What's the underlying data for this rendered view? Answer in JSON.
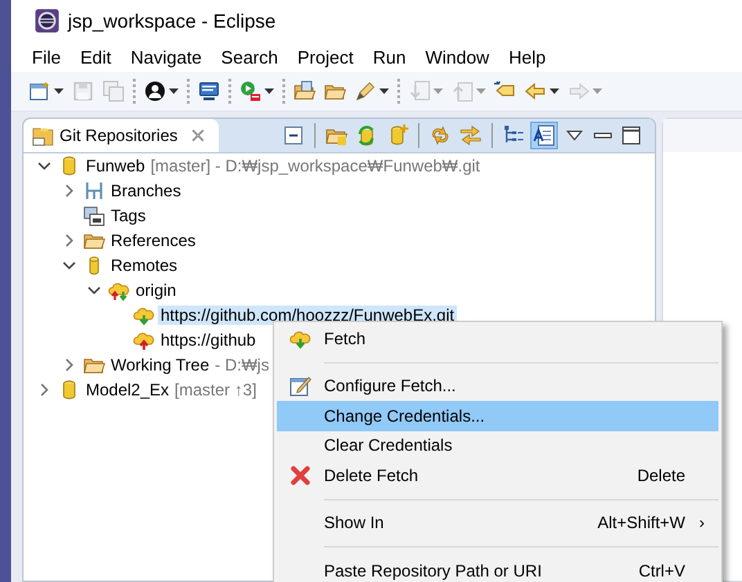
{
  "window": {
    "title": "jsp_workspace - Eclipse"
  },
  "menu_bar": [
    "File",
    "Edit",
    "Navigate",
    "Search",
    "Project",
    "Run",
    "Window",
    "Help"
  ],
  "toolbar": [
    {
      "kind": "new",
      "disabled": false,
      "dropdown": true
    },
    {
      "kind": "save",
      "disabled": true,
      "dropdown": false
    },
    {
      "kind": "save-all",
      "disabled": true,
      "dropdown": false
    },
    {
      "kind": "separator"
    },
    {
      "kind": "user",
      "disabled": false,
      "dropdown": true
    },
    {
      "kind": "separator"
    },
    {
      "kind": "monitor",
      "disabled": false,
      "dropdown": false
    },
    {
      "kind": "separator"
    },
    {
      "kind": "run",
      "disabled": false,
      "dropdown": true
    },
    {
      "kind": "separator"
    },
    {
      "kind": "open-folder",
      "disabled": false,
      "dropdown": false
    },
    {
      "kind": "folder",
      "disabled": false,
      "dropdown": false
    },
    {
      "kind": "pen",
      "disabled": false,
      "dropdown": true
    },
    {
      "kind": "separator"
    },
    {
      "kind": "next",
      "disabled": true,
      "dropdown": true
    },
    {
      "kind": "prev",
      "disabled": true,
      "dropdown": true
    },
    {
      "kind": "last-edit",
      "disabled": false,
      "dropdown": false
    },
    {
      "kind": "back",
      "disabled": false,
      "dropdown": true
    },
    {
      "kind": "forward",
      "disabled": true,
      "dropdown": true
    }
  ],
  "view": {
    "tab": {
      "label": "Git Repositories",
      "selected": true
    },
    "view_toolbar": [
      {
        "kind": "collapse",
        "on": false
      },
      {
        "kind": "sep"
      },
      {
        "kind": "add-repo",
        "on": false
      },
      {
        "kind": "clone",
        "on": false
      },
      {
        "kind": "create",
        "on": false
      },
      {
        "kind": "sep"
      },
      {
        "kind": "link",
        "on": false
      },
      {
        "kind": "sync",
        "on": false
      },
      {
        "kind": "sep"
      },
      {
        "kind": "tree",
        "on": false
      },
      {
        "kind": "doc",
        "on": true
      },
      {
        "kind": "view-menu",
        "on": false
      },
      {
        "kind": "minimize",
        "on": false
      },
      {
        "kind": "maximize",
        "on": false
      }
    ],
    "tree": [
      {
        "kind": "repo",
        "label": "Funweb",
        "detail": "[master] - D:₩jsp_workspace₩Funweb₩.git",
        "expanded": true,
        "selected": false,
        "children": [
          {
            "kind": "branches",
            "label": "Branches",
            "expanded": false,
            "selected": false
          },
          {
            "kind": "tags",
            "label": "Tags",
            "selected": false
          },
          {
            "kind": "folder",
            "label": "References",
            "expanded": false,
            "selected": false
          },
          {
            "kind": "remotes",
            "label": "Remotes",
            "expanded": true,
            "selected": false,
            "children": [
              {
                "kind": "remote",
                "label": "origin",
                "expanded": true,
                "selected": false,
                "children": [
                  {
                    "kind": "fetch",
                    "label": "https://github.com/hoozzz/FunwebEx.git",
                    "selected": true
                  },
                  {
                    "kind": "push",
                    "label": "https://github",
                    "selected": false
                  }
                ]
              }
            ]
          },
          {
            "kind": "folder",
            "label": "Working Tree",
            "detail": "- D:₩js",
            "expanded": false,
            "selected": false
          }
        ]
      },
      {
        "kind": "repo",
        "label": "Model2_Ex",
        "detail": "[master ↑3]",
        "expanded": false,
        "selected": false
      }
    ]
  },
  "context_menu": [
    {
      "kind": "fetch",
      "label": "Fetch",
      "selected": false
    },
    {
      "kind": "separator"
    },
    {
      "kind": "edit",
      "label": "Configure Fetch...",
      "selected": false
    },
    {
      "kind": "item",
      "label": "Change Credentials...",
      "selected": true
    },
    {
      "kind": "item",
      "label": "Clear Credentials",
      "selected": false
    },
    {
      "kind": "delete",
      "label": "Delete Fetch",
      "shortcut": "Delete",
      "selected": false
    },
    {
      "kind": "separator"
    },
    {
      "kind": "item",
      "label": "Show In",
      "shortcut": "Alt+Shift+W",
      "submenu": "›",
      "selected": false
    },
    {
      "kind": "separator"
    },
    {
      "kind": "item",
      "label": "Paste Repository Path or URI",
      "shortcut": "Ctrl+V",
      "selected": false
    }
  ]
}
